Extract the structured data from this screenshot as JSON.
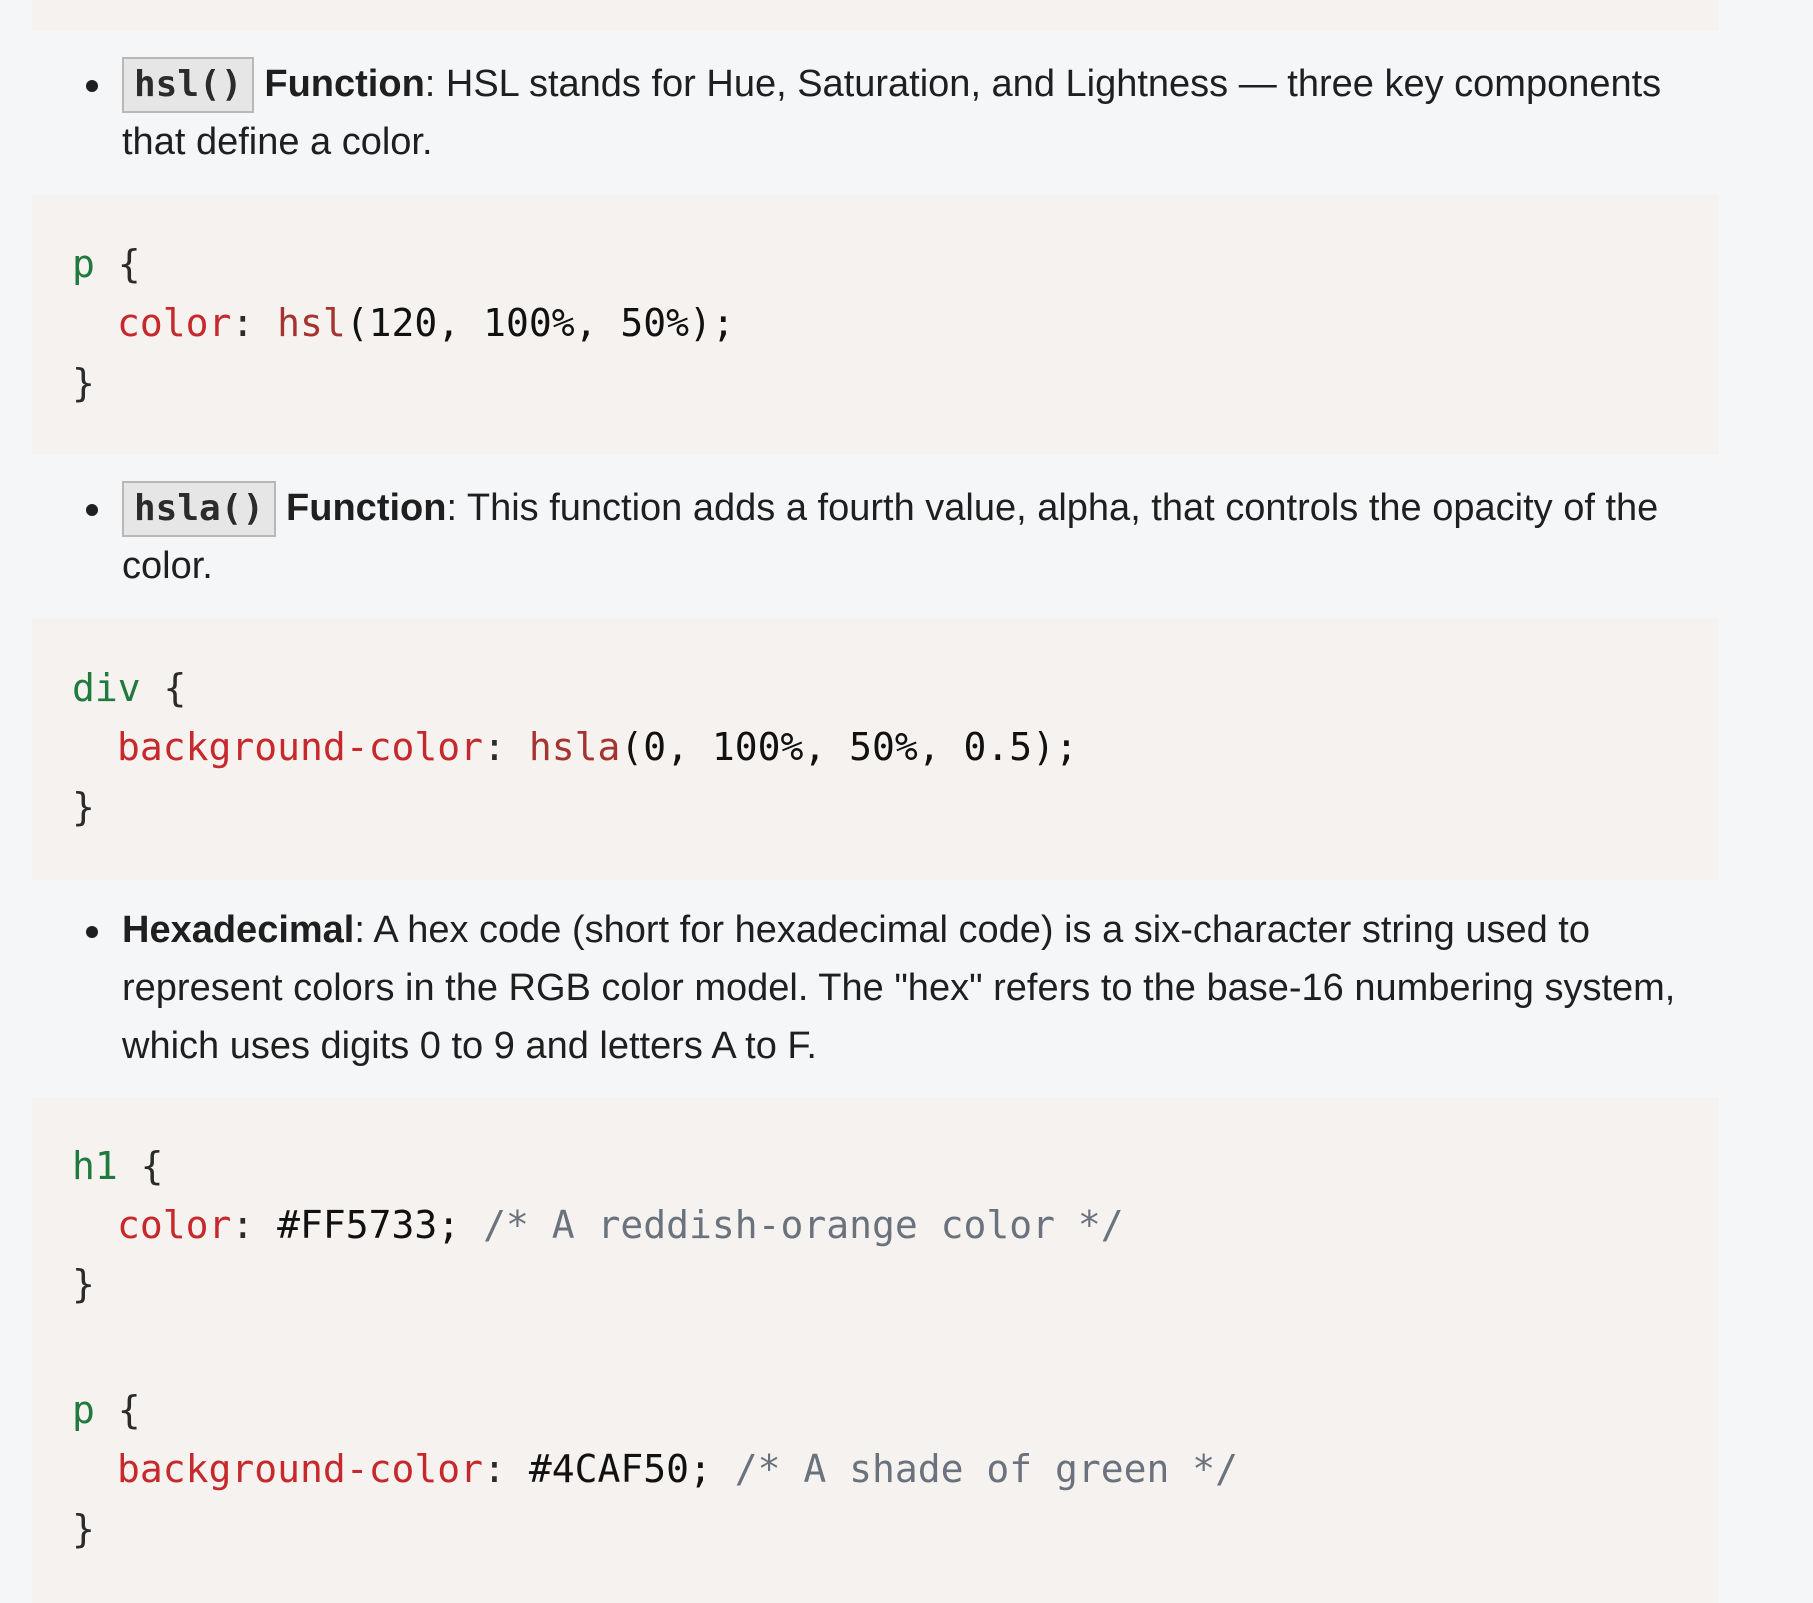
{
  "items": [
    {
      "code_label": "hsl()",
      "term": "Function",
      "description": ": HSL stands for Hue, Saturation, and Lightness — three key components that define a color.",
      "code_lines": [
        {
          "selector": "p",
          "brace": " {"
        },
        {
          "property": "color",
          "colon": ": ",
          "fn": "hsl",
          "args": "(120, 100%, 50%);"
        },
        {
          "close": "}"
        }
      ]
    },
    {
      "code_label": "hsla()",
      "term": "Function",
      "description": ": This function adds a fourth value, alpha, that controls the opacity of the color.",
      "code_lines": [
        {
          "selector": "div",
          "brace": " {"
        },
        {
          "property": "background-color",
          "colon": ": ",
          "fn": "hsla",
          "args": "(0, 100%, 50%, 0.5);"
        },
        {
          "close": "}"
        }
      ]
    },
    {
      "term": "Hexadecimal",
      "description": ": A hex code (short for hexadecimal code) is a six-character string used to represent colors in the RGB color model. The \"hex\" refers to the base-16 numbering system, which uses digits 0 to 9 and letters A to F.",
      "code_lines": [
        {
          "selector": "h1",
          "brace": " {"
        },
        {
          "property": "color",
          "colon": ": ",
          "value": "#FF5733;",
          "comment": " /* A reddish-orange color */"
        },
        {
          "close": "}"
        },
        {
          "selector": "p",
          "brace": " {"
        },
        {
          "property": "background-color",
          "colon": ": ",
          "value": "#4CAF50;",
          "comment": " /* A shade of green */"
        },
        {
          "close": "}"
        }
      ]
    }
  ]
}
